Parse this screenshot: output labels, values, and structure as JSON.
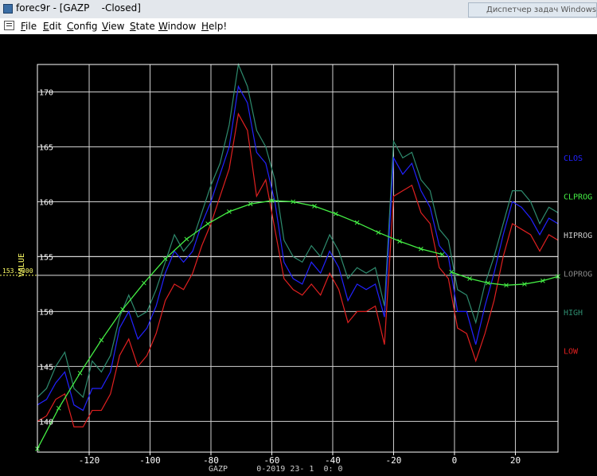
{
  "window": {
    "title": "forec9r - [GAZP    -Closed]",
    "background_task": "Диспетчер задач Windows"
  },
  "menu": [
    {
      "label": "File",
      "u": "F"
    },
    {
      "label": "Edit",
      "u": "E"
    },
    {
      "label": "Config",
      "u": "C"
    },
    {
      "label": "View",
      "u": "V"
    },
    {
      "label": "State",
      "u": "S"
    },
    {
      "label": "Window",
      "u": "W"
    },
    {
      "label": "Help!",
      "u": "H"
    }
  ],
  "chart_data": {
    "type": "line",
    "ylabel": "VALUE",
    "xlim": [
      -137,
      34
    ],
    "ylim": [
      137.2,
      172.5
    ],
    "xticks": [
      -120,
      -100,
      -80,
      -60,
      -40,
      -20,
      0,
      20
    ],
    "yticks": [
      140,
      145,
      150,
      155,
      160,
      165,
      170
    ],
    "hlines": [
      155,
      153.3
    ],
    "cursor": {
      "value": 153.3,
      "label": "153.5300"
    },
    "footer": "GAZP      0-2019 23- 1  0: 0",
    "colors": {
      "clos": "#2222ff",
      "high": "#2e8b6e",
      "low": "#e02020",
      "clprog": "#44ee44",
      "hiprog": "#cccccc",
      "loprog": "#888888",
      "grid": "#d0d0d0"
    },
    "legend": [
      "CLOS",
      "CLPROG",
      "HIPROG",
      "LOPROG",
      "HIGH",
      "LOW"
    ],
    "x": [
      -137,
      -134,
      -131,
      -128,
      -125,
      -122,
      -119,
      -116,
      -113,
      -110,
      -107,
      -104,
      -101,
      -98,
      -95,
      -92,
      -89,
      -86,
      -83,
      -80,
      -77,
      -74,
      -71,
      -68,
      -65,
      -62,
      -59,
      -56,
      -53,
      -50,
      -47,
      -44,
      -41,
      -38,
      -35,
      -32,
      -29,
      -26,
      -23,
      -20,
      -17,
      -14,
      -11,
      -8,
      -5,
      -2,
      1,
      4,
      7,
      10,
      13,
      16,
      19,
      22,
      25,
      28,
      31,
      34
    ],
    "series": [
      {
        "name": "HIGH",
        "values": [
          142.2,
          143.0,
          145.0,
          146.3,
          143.0,
          142.2,
          145.5,
          144.5,
          146.0,
          149.5,
          151.5,
          149.5,
          150.0,
          152.0,
          154.5,
          157.0,
          155.5,
          156.5,
          159.0,
          161.5,
          163.5,
          167.0,
          172.5,
          170.5,
          166.5,
          165.0,
          162.0,
          156.5,
          155.0,
          154.5,
          156.0,
          155.0,
          157.0,
          155.5,
          153.0,
          154.0,
          153.5,
          154.0,
          150.5,
          165.5,
          164.0,
          164.5,
          162.0,
          161.0,
          157.5,
          156.5,
          152.0,
          151.5,
          149.0,
          152.5,
          155.0,
          158.0,
          161.0,
          161.0,
          160.0,
          158.0,
          159.5,
          159.0
        ]
      },
      {
        "name": "CLOS",
        "values": [
          141.5,
          142.0,
          143.5,
          144.5,
          141.5,
          141.0,
          143.0,
          143.0,
          144.5,
          148.5,
          150.0,
          147.5,
          148.5,
          150.5,
          153.5,
          155.5,
          154.5,
          155.5,
          158.0,
          160.0,
          162.5,
          165.0,
          170.5,
          169.0,
          164.5,
          163.5,
          160.0,
          154.5,
          153.0,
          152.5,
          154.5,
          153.5,
          155.5,
          154.0,
          151.0,
          152.5,
          152.0,
          152.5,
          149.5,
          164.0,
          162.5,
          163.5,
          161.0,
          159.5,
          156.0,
          155.0,
          150.0,
          150.0,
          147.0,
          150.5,
          153.5,
          157.0,
          160.0,
          159.5,
          158.5,
          157.0,
          158.5,
          158.0
        ]
      },
      {
        "name": "LOW",
        "values": [
          140.0,
          140.5,
          142.0,
          142.5,
          139.5,
          139.5,
          141.0,
          141.0,
          142.5,
          146.0,
          147.5,
          145.0,
          146.0,
          148.0,
          151.0,
          152.5,
          152.0,
          153.5,
          156.0,
          158.0,
          160.5,
          163.0,
          168.0,
          166.5,
          160.5,
          162.0,
          157.5,
          153.0,
          152.0,
          151.5,
          152.5,
          151.5,
          153.5,
          152.0,
          149.0,
          150.0,
          150.0,
          150.5,
          147.0,
          160.5,
          161.0,
          161.5,
          159.0,
          158.0,
          154.0,
          153.0,
          148.5,
          148.0,
          145.5,
          148.0,
          151.0,
          155.0,
          158.0,
          157.5,
          157.0,
          155.5,
          157.0,
          156.5
        ]
      }
    ],
    "forecast_segments": [
      {
        "name": "CLPROG",
        "x": [
          -137,
          -130,
          -123,
          -116,
          -109,
          -102,
          -95,
          -88,
          -81,
          -74,
          -67,
          -60,
          -53,
          -46,
          -39,
          -32,
          -25,
          -18,
          -11,
          -4
        ],
        "values": [
          137.5,
          141.2,
          144.4,
          147.4,
          150.2,
          152.6,
          154.8,
          156.6,
          158.0,
          159.1,
          159.8,
          160.1,
          160.0,
          159.6,
          158.9,
          158.1,
          157.2,
          156.4,
          155.7,
          155.2
        ]
      },
      {
        "name": "CLPROG",
        "x": [
          -1,
          5,
          11,
          17,
          23,
          29,
          34
        ],
        "values": [
          153.6,
          153.0,
          152.6,
          152.4,
          152.5,
          152.8,
          153.2
        ]
      }
    ]
  }
}
